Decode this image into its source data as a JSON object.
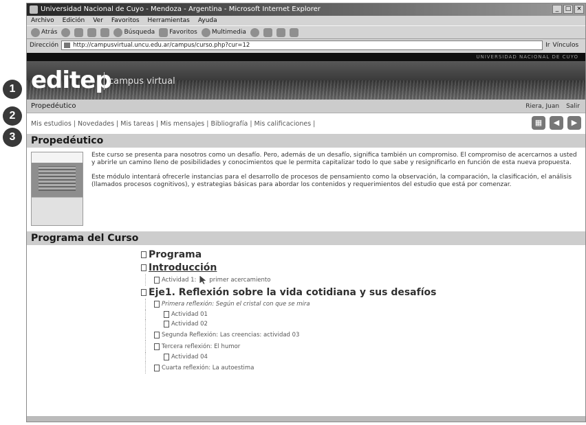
{
  "markers": [
    "1",
    "2",
    "3"
  ],
  "browser": {
    "title": "Universidad Nacional de Cuyo - Mendoza - Argentina - Microsoft Internet Explorer",
    "menu": [
      "Archivo",
      "Edición",
      "Ver",
      "Favoritos",
      "Herramientas",
      "Ayuda"
    ],
    "toolbar": {
      "back": "Atrás",
      "search": "Búsqueda",
      "favorites": "Favoritos",
      "multimedia": "Multimedia"
    },
    "address_label": "Dirección",
    "url": "http://campusvirtual.uncu.edu.ar/campus/curso.php?cur=12",
    "go_label": "Ir",
    "links_label": "Vínculos"
  },
  "site": {
    "top_strip": "UNIVERSIDAD NACIONAL DE CUYO",
    "logo": "editep",
    "logo_sub": "campus virtual",
    "breadcrumb": "Propedéutico",
    "user": "Riera, Juan",
    "logout": "Salir",
    "nav": [
      "Mis estudios",
      "Novedades",
      "Mis tareas",
      "Mis mensajes",
      "Bibliografía",
      "Mis calificaciones"
    ]
  },
  "course": {
    "heading": "Propedéutico",
    "para1": "Este curso se presenta para nosotros como un desafío. Pero, además de un desafío, significa también un compromiso. El compromiso de acercarnos a usted y abrirle un camino lleno de posibilidades y conocimientos que le permita capitalizar todo lo que sabe y resignificarlo en función de esta nueva propuesta.",
    "para2": "Este módulo intentará ofrecerle instancias para el desarrollo de procesos de pensamiento como la observación, la comparación, la clasificación, el análisis (llamados procesos cognitivos), y estrategias básicas para abordar los contenidos y requerimientos del estudio que está por comenzar."
  },
  "programa": {
    "heading": "Programa del Curso",
    "item_programa": "Programa",
    "item_intro": "Introducción",
    "act1_prefix": "Actividad 1:",
    "act1_text": "primer acercamiento",
    "eje1": "Eje1. Reflexión sobre la vida cotidiana y sus desafíos",
    "r1": "Primera reflexión: Según el cristal con que se mira",
    "r1_act1": "Actividad 01",
    "r1_act2": "Actividad 02",
    "r2": "Segunda Reflexión: Las creencias: actividad 03",
    "r3": "Tercera reflexión: El humor",
    "r3_act": "Actividad 04",
    "r4": "Cuarta reflexión: La autoestima"
  }
}
